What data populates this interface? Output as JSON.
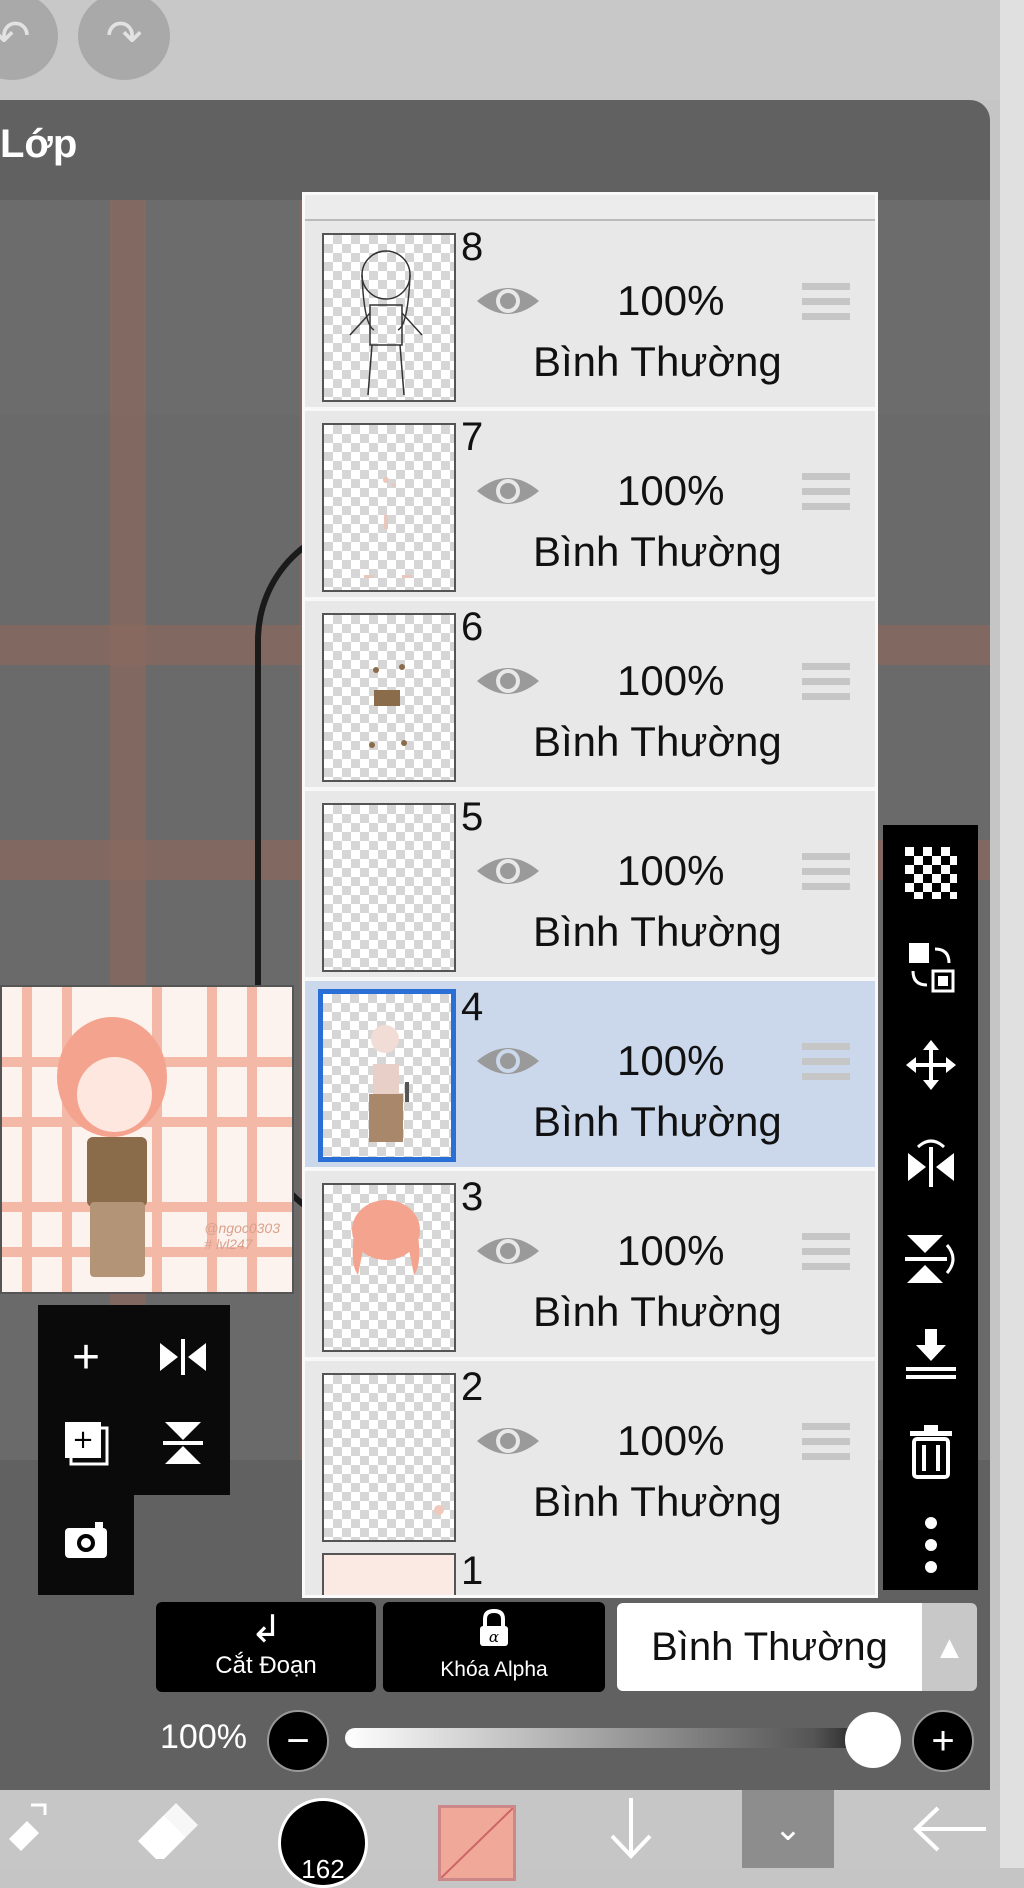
{
  "panel": {
    "title": "Lớp"
  },
  "preview": {
    "signature_line1": "@ngoc0303",
    "signature_line2": "# lvl247"
  },
  "layers": [
    {
      "number": "8",
      "opacity": "100%",
      "blend": "Bình Thường",
      "selected": false
    },
    {
      "number": "7",
      "opacity": "100%",
      "blend": "Bình Thường",
      "selected": false
    },
    {
      "number": "6",
      "opacity": "100%",
      "blend": "Bình Thường",
      "selected": false
    },
    {
      "number": "5",
      "opacity": "100%",
      "blend": "Bình Thường",
      "selected": false
    },
    {
      "number": "4",
      "opacity": "100%",
      "blend": "Bình Thường",
      "selected": true
    },
    {
      "number": "3",
      "opacity": "100%",
      "blend": "Bình Thường",
      "selected": false
    },
    {
      "number": "2",
      "opacity": "100%",
      "blend": "Bình Thường",
      "selected": false
    }
  ],
  "layer_partial": {
    "number": "1"
  },
  "controls": {
    "clipping_label": "Cắt Đoạn",
    "alpha_lock_label": "Khóa Alpha",
    "blend_mode": "Bình Thường"
  },
  "opacity": {
    "label": "100%",
    "value": 1.0
  },
  "toolbar": {
    "brush_size": "162",
    "color": "#f0a898"
  },
  "icons": {
    "top": [
      "undo-icon",
      "redo-icon"
    ],
    "quick": [
      "add-layer-icon",
      "flip-horizontal-icon",
      "add-layer-copy-icon",
      "flip-vertical-icon",
      "camera-icon"
    ],
    "right": [
      "transparency-icon",
      "swap-layer-icon",
      "move-icon",
      "flip-horizontal-icon",
      "flip-vertical-icon",
      "merge-down-icon",
      "trash-icon",
      "more-icon"
    ],
    "bottom": [
      "tool-switch-icon",
      "eraser-icon",
      "brush-size-icon",
      "color-icon",
      "arrow-down-icon",
      "chevron-down-icon",
      "back-icon"
    ]
  }
}
